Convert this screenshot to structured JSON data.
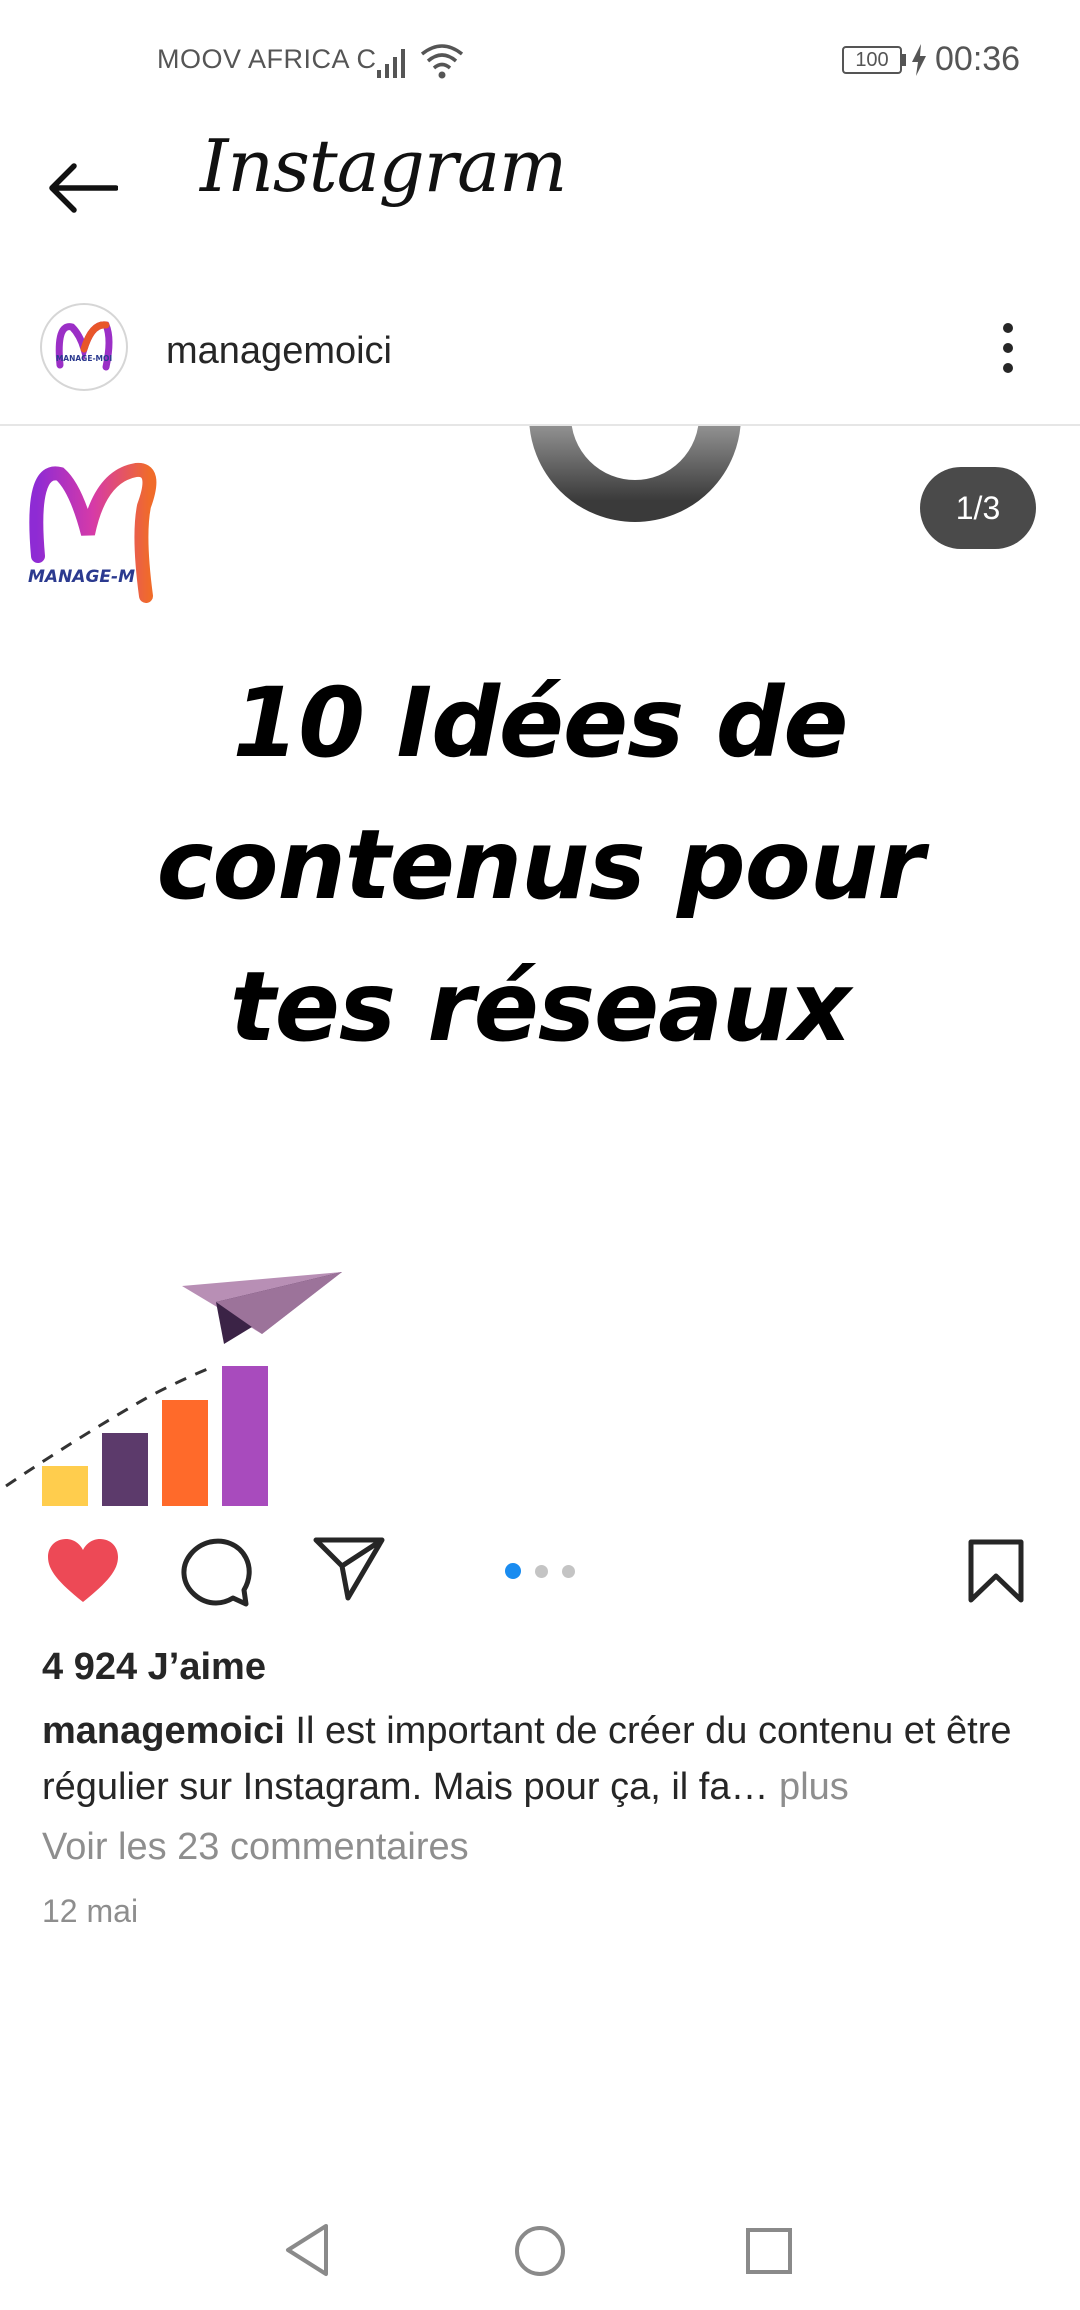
{
  "status_bar": {
    "carrier": "MOOV AFRICA C",
    "battery": "100",
    "time": "00:36"
  },
  "header": {
    "title": "Instagram",
    "back_icon": "arrow-left-icon"
  },
  "post": {
    "username": "managemoici",
    "avatar_text": "MANAGE-MOI",
    "menu_icon": "more-vertical-icon",
    "image": {
      "slide_counter": "1/3",
      "logo_text": "MANAGE-M",
      "headline_lines": [
        "10 Idées de",
        "contenus pour",
        "tes réseaux"
      ]
    },
    "carousel": {
      "total": 3,
      "active_index": 0
    },
    "actions": {
      "like_icon": "heart-filled-icon",
      "comment_icon": "comment-icon",
      "share_icon": "paper-plane-icon",
      "save_icon": "bookmark-icon"
    },
    "likes": "4 924 J’aime",
    "caption_user": "managemoici",
    "caption_text": " Il est important de créer du contenu et être régulier sur Instagram. Mais pour ça, il fa…",
    "caption_more": " plus",
    "comments_link": "Voir les 23 commentaires",
    "date": "12 mai"
  },
  "colors": {
    "like_red": "#ed4956",
    "dot_active": "#1a8cf0",
    "muted_text": "#8e8e8e"
  },
  "nav_bar": {
    "back": "nav-back-icon",
    "home": "nav-home-icon",
    "recents": "nav-recents-icon"
  }
}
